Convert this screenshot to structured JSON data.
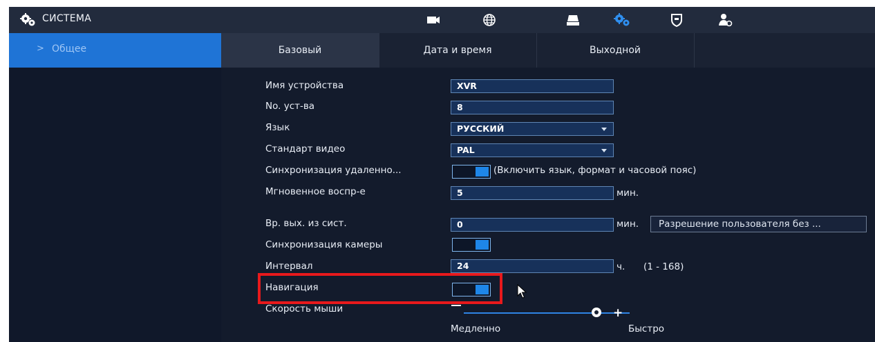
{
  "header": {
    "title": "СИСТЕМА",
    "icons": [
      "camera-icon",
      "network-icon",
      "storage-icon",
      "system-icon",
      "security-icon",
      "account-icon"
    ]
  },
  "sidebar": {
    "items": [
      {
        "label": "Общее",
        "chevron": ">"
      }
    ]
  },
  "tabs": [
    {
      "label": "Базовый"
    },
    {
      "label": "Дата и время"
    },
    {
      "label": "Выходной"
    }
  ],
  "form": {
    "device_name": {
      "label": "Имя устройства",
      "value": "XVR"
    },
    "device_no": {
      "label": "No. уст-ва",
      "value": "8"
    },
    "language": {
      "label": "Язык",
      "value": "РУССКИЙ"
    },
    "video_standard": {
      "label": "Стандарт видео",
      "value": "PAL"
    },
    "remote_sync": {
      "label": "Синхронизация удаленно...",
      "note": "(Включить язык, формат и часовой пояс)",
      "enabled": true
    },
    "instant_playback": {
      "label": "Мгновенное воспр-е",
      "value": "5",
      "unit": "мин."
    },
    "logout_time": {
      "label": "Вр. вых. из сист.",
      "value": "0",
      "unit": "мин.",
      "button": "Разрешение пользователя без ..."
    },
    "camera_sync": {
      "label": "Синхронизация камеры",
      "enabled": true
    },
    "interval": {
      "label": "Интервал",
      "value": "24",
      "unit": "ч.",
      "range": "(1 - 168)"
    },
    "navigation": {
      "label": "Навигация",
      "enabled": true
    },
    "mouse_speed": {
      "label": "Скорость мыши",
      "slow": "Медленно",
      "fast": "Быстро",
      "level": 0.8
    }
  },
  "colors": {
    "accent": "#1f74d6",
    "highlight": "#e8191c",
    "background": "#11192a"
  }
}
